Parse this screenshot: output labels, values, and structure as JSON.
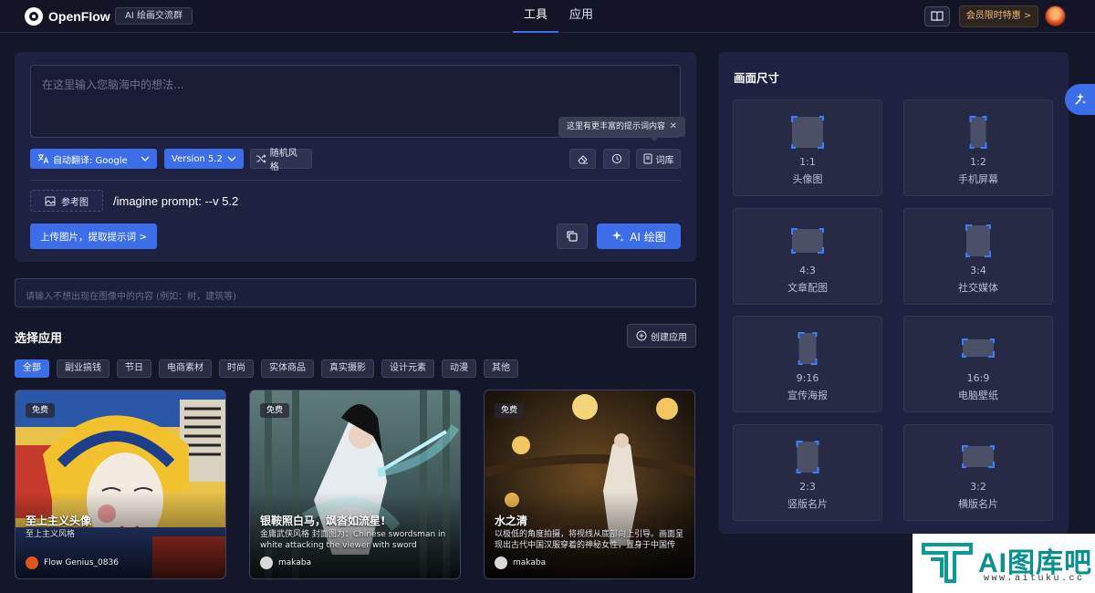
{
  "header": {
    "app_name": "OpenFlow",
    "group_badge": "AI 绘画交流群",
    "nav": [
      "工具",
      "应用"
    ],
    "vip_label": "会员限时特惠 >"
  },
  "prompt": {
    "placeholder": "在这里输入您脑海中的想法...",
    "tip": "这里有更丰富的提示词内容",
    "translate_label": "自动翻译:  Google",
    "version_label": "Version 5.2",
    "random_style_label": "随机风格",
    "library_label": "词库",
    "reference_label": "参考图",
    "command_text": "/imagine prompt:  --v 5.2",
    "upload_label": "上传图片，提取提示词 >",
    "draw_label": "AI 绘图"
  },
  "negative_prompt": {
    "placeholder": "请输入不想出现在图像中的内容 (例如：树，建筑等)"
  },
  "apps": {
    "title": "选择应用",
    "create_label": "创建应用",
    "categories": [
      "全部",
      "副业搞钱",
      "节日",
      "电商素材",
      "时尚",
      "实体商品",
      "真实摄影",
      "设计元素",
      "动漫",
      "其他"
    ],
    "cards": [
      {
        "tag": "免费",
        "title": "至上主义头像",
        "desc": "至上主义风格",
        "author": "Flow Genius_0836"
      },
      {
        "tag": "免费",
        "title": "银鞍照白马，飒沓如流星!",
        "desc": "金庸武侠风格 封面图为：Chinese swordsman in white attacking the viewer with sword",
        "author": "makaba"
      },
      {
        "tag": "免费",
        "title": "水之清",
        "desc": "以极低的角度拍摄，将视线从底部向上引导。画面呈现出古代中国汉服穿着的神秘女性，置身于中国传统...",
        "author": "makaba"
      }
    ]
  },
  "size_panel": {
    "title": "画面尺寸",
    "options": [
      {
        "ratio": "1:1",
        "label": "头像图"
      },
      {
        "ratio": "1:2",
        "label": "手机屏幕"
      },
      {
        "ratio": "4:3",
        "label": "文章配图"
      },
      {
        "ratio": "3:4",
        "label": "社交媒体"
      },
      {
        "ratio": "9:16",
        "label": "宣传海报"
      },
      {
        "ratio": "16:9",
        "label": "电脑壁纸"
      },
      {
        "ratio": "2:3",
        "label": "竖版名片"
      },
      {
        "ratio": "3:2",
        "label": "横版名片"
      }
    ]
  },
  "watermark": {
    "text": "AI图库吧",
    "url": "www.aituku.cc"
  },
  "colors": {
    "accent": "#3d6eea",
    "background": "#141629",
    "panel": "#1e2140",
    "vip": "#f0b76e"
  },
  "icons": [
    "openflow-logo-icon",
    "book-icon",
    "translate-icon",
    "chevron-down-icon",
    "shuffle-icon",
    "eraser-icon",
    "history-icon",
    "library-icon",
    "image-icon",
    "copy-icon",
    "sparkle-icon",
    "plus-circle-icon",
    "magic-wand-icon"
  ]
}
